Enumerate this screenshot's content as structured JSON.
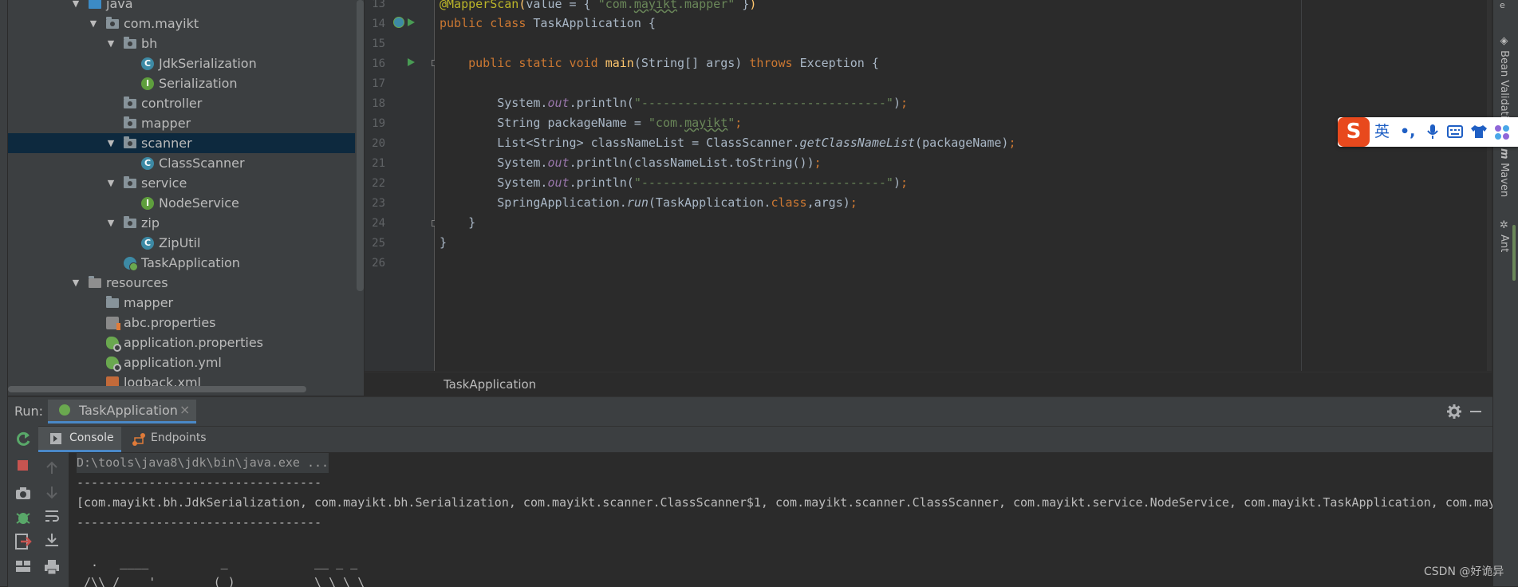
{
  "project_tree": {
    "items": [
      {
        "label": "java",
        "indent": 1,
        "arrow": "▼",
        "icon": "folder-blue"
      },
      {
        "label": "com.mayikt",
        "indent": 2,
        "arrow": "▼",
        "icon": "package"
      },
      {
        "label": "bh",
        "indent": 3,
        "arrow": "▼",
        "icon": "package"
      },
      {
        "label": "JdkSerialization",
        "indent": 4,
        "arrow": "",
        "icon": "class"
      },
      {
        "label": "Serialization",
        "indent": 4,
        "arrow": "",
        "icon": "interface"
      },
      {
        "label": "controller",
        "indent": 3,
        "arrow": "",
        "icon": "package"
      },
      {
        "label": "mapper",
        "indent": 3,
        "arrow": "",
        "icon": "package"
      },
      {
        "label": "scanner",
        "indent": 3,
        "arrow": "▼",
        "icon": "package",
        "selected": true
      },
      {
        "label": "ClassScanner",
        "indent": 4,
        "arrow": "",
        "icon": "class"
      },
      {
        "label": "service",
        "indent": 3,
        "arrow": "▼",
        "icon": "package"
      },
      {
        "label": "NodeService",
        "indent": 4,
        "arrow": "",
        "icon": "interface"
      },
      {
        "label": "zip",
        "indent": 3,
        "arrow": "▼",
        "icon": "package"
      },
      {
        "label": "ZipUtil",
        "indent": 4,
        "arrow": "",
        "icon": "class"
      },
      {
        "label": "TaskApplication",
        "indent": 3,
        "arrow": "",
        "icon": "spring-class"
      },
      {
        "label": "resources",
        "indent": 1,
        "arrow": "▼",
        "icon": "folder-resources"
      },
      {
        "label": "mapper",
        "indent": 2,
        "arrow": "",
        "icon": "folder"
      },
      {
        "label": "abc.properties",
        "indent": 2,
        "arrow": "",
        "icon": "properties"
      },
      {
        "label": "application.properties",
        "indent": 2,
        "arrow": "",
        "icon": "spring-file"
      },
      {
        "label": "application.yml",
        "indent": 2,
        "arrow": "",
        "icon": "spring-file"
      },
      {
        "label": "logback.xml",
        "indent": 2,
        "arrow": "",
        "icon": "xml"
      }
    ]
  },
  "editor": {
    "line_numbers": [
      "13",
      "14",
      "15",
      "16",
      "17",
      "18",
      "19",
      "20",
      "21",
      "22",
      "23",
      "24",
      "25",
      "26"
    ],
    "breadcrumb": "TaskApplication"
  },
  "ime": {
    "logo": "S",
    "mode": "英",
    "punct": "•,"
  },
  "right_tabs": {
    "bean_validation": "Bean Validation",
    "maven": "Maven",
    "ant": "Ant"
  },
  "run_panel": {
    "label": "Run:",
    "tab_label": "TaskApplication",
    "tab_close": "×",
    "console_tab": "Console",
    "endpoints_tab": "Endpoints",
    "console_lines": [
      "D:\\tools\\java8\\jdk\\bin\\java.exe ...",
      "----------------------------------",
      "[com.mayikt.bh.JdkSerialization, com.mayikt.bh.Serialization, com.mayikt.scanner.ClassScanner$1, com.mayikt.scanner.ClassScanner, com.mayikt.service.NodeService, com.mayikt.TaskApplication, com.mayikt",
      "----------------------------------",
      "",
      "  .   ____          _            __ _ _",
      " /\\\\ / ___'_ __ _ _(_)_ __  __ _ \\ \\ \\ \\"
    ]
  },
  "watermark": "CSDN @好诡异",
  "colors": {
    "keyword": "#cc7832",
    "string": "#6a8759",
    "annotation": "#bbb529",
    "field": "#9876aa",
    "method": "#ffc66d",
    "selection": "#0d293e",
    "tab_underline": "#4a88c7"
  }
}
